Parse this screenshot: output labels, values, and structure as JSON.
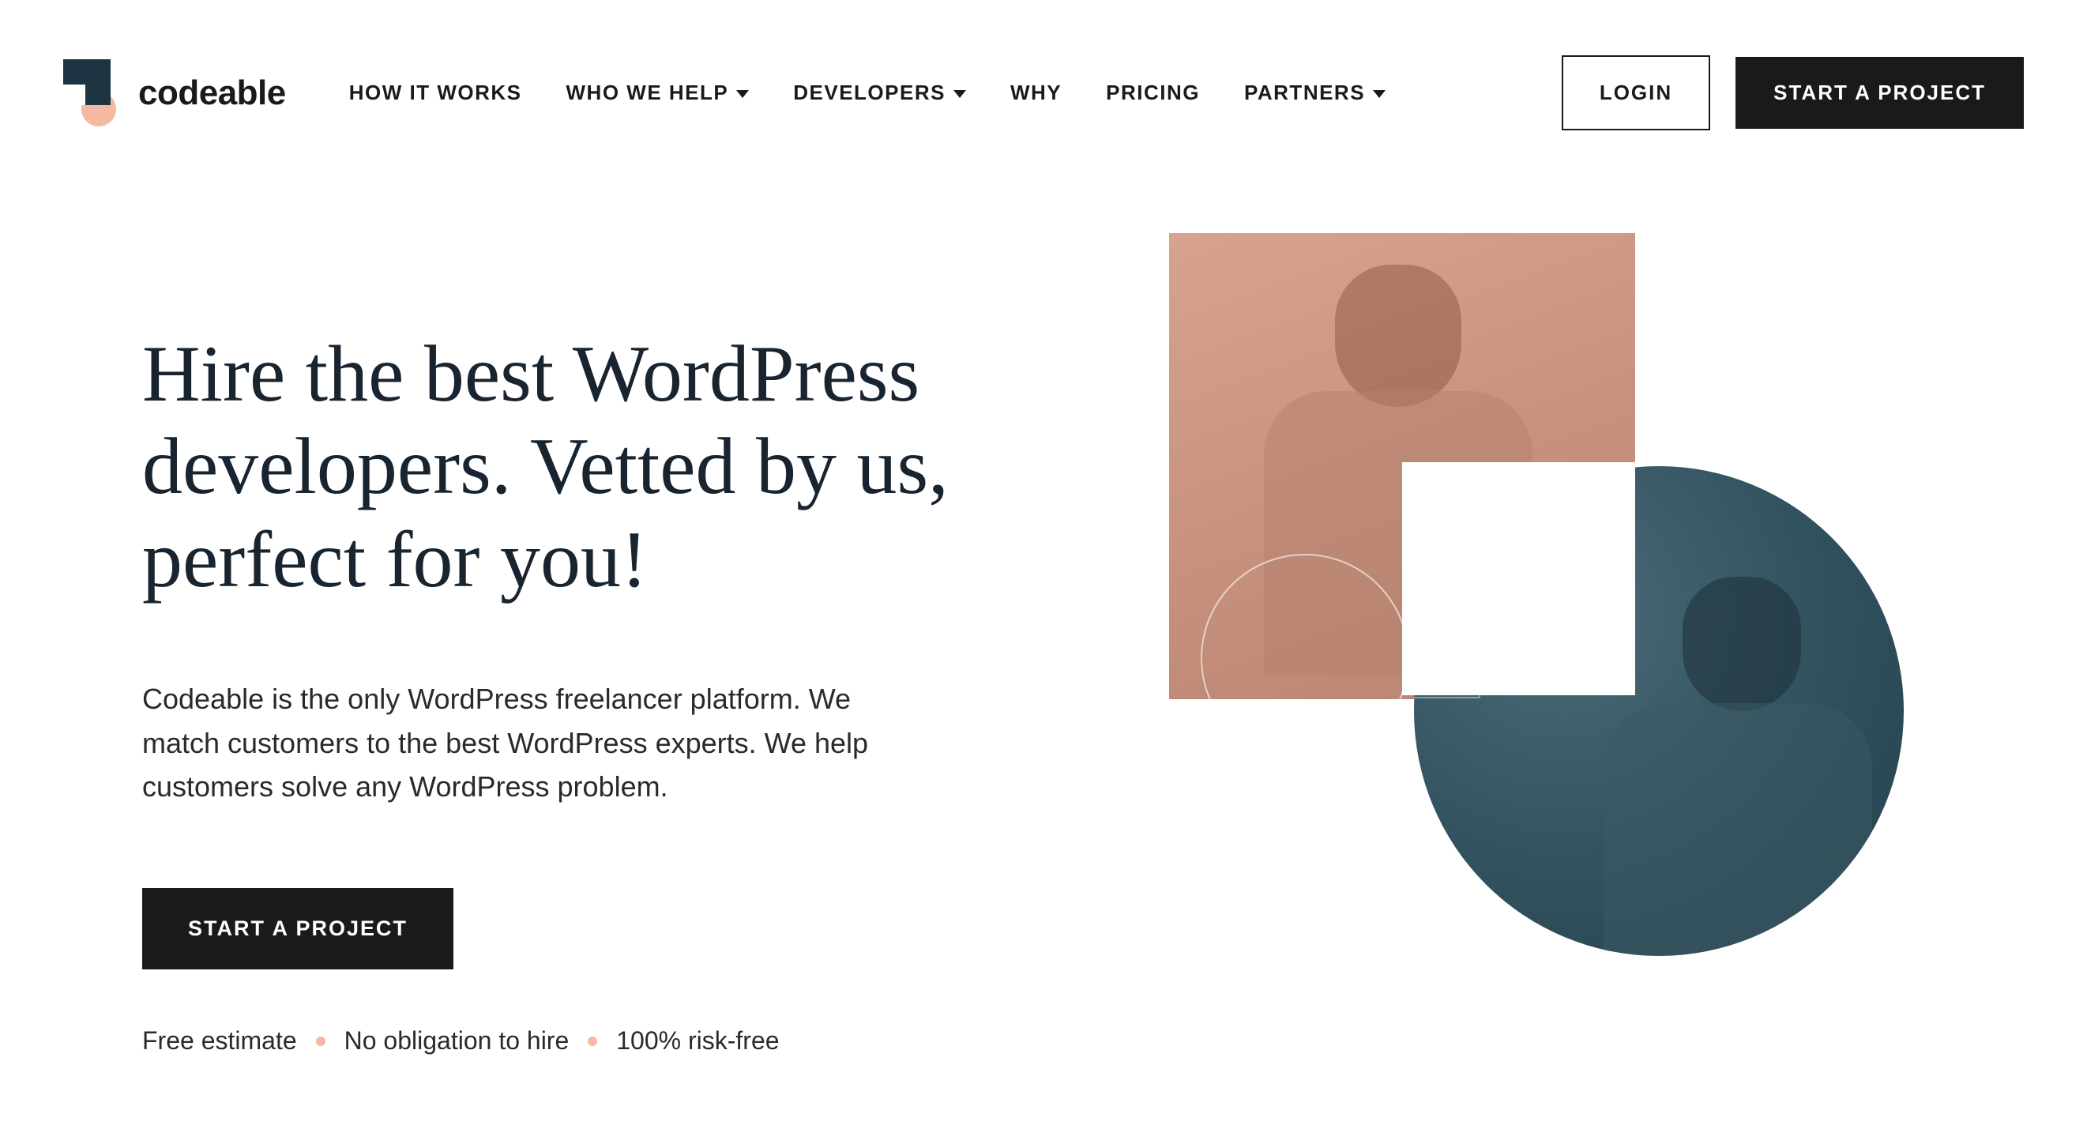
{
  "brand": {
    "name": "codeable"
  },
  "nav": {
    "items": [
      {
        "label": "HOW IT WORKS",
        "hasDropdown": false
      },
      {
        "label": "WHO WE HELP",
        "hasDropdown": true
      },
      {
        "label": "DEVELOPERS",
        "hasDropdown": true
      },
      {
        "label": "WHY",
        "hasDropdown": false
      },
      {
        "label": "PRICING",
        "hasDropdown": false
      },
      {
        "label": "PARTNERS",
        "hasDropdown": true
      }
    ]
  },
  "header": {
    "login": "LOGIN",
    "cta": "START A PROJECT"
  },
  "hero": {
    "title": "Hire the best WordPress developers. Vetted by us, perfect for you!",
    "description": "Codeable is the only WordPress freelancer platform. We match customers to the best WordPress experts. We help customers solve any WordPress problem.",
    "cta": "START A PROJECT",
    "benefits": [
      "Free estimate",
      "No obligation to hire",
      "100% risk-free"
    ]
  },
  "colors": {
    "dark": "#1a1a1a",
    "navy": "#182430",
    "peach": "#f5b8a0",
    "teal": "#335360"
  }
}
